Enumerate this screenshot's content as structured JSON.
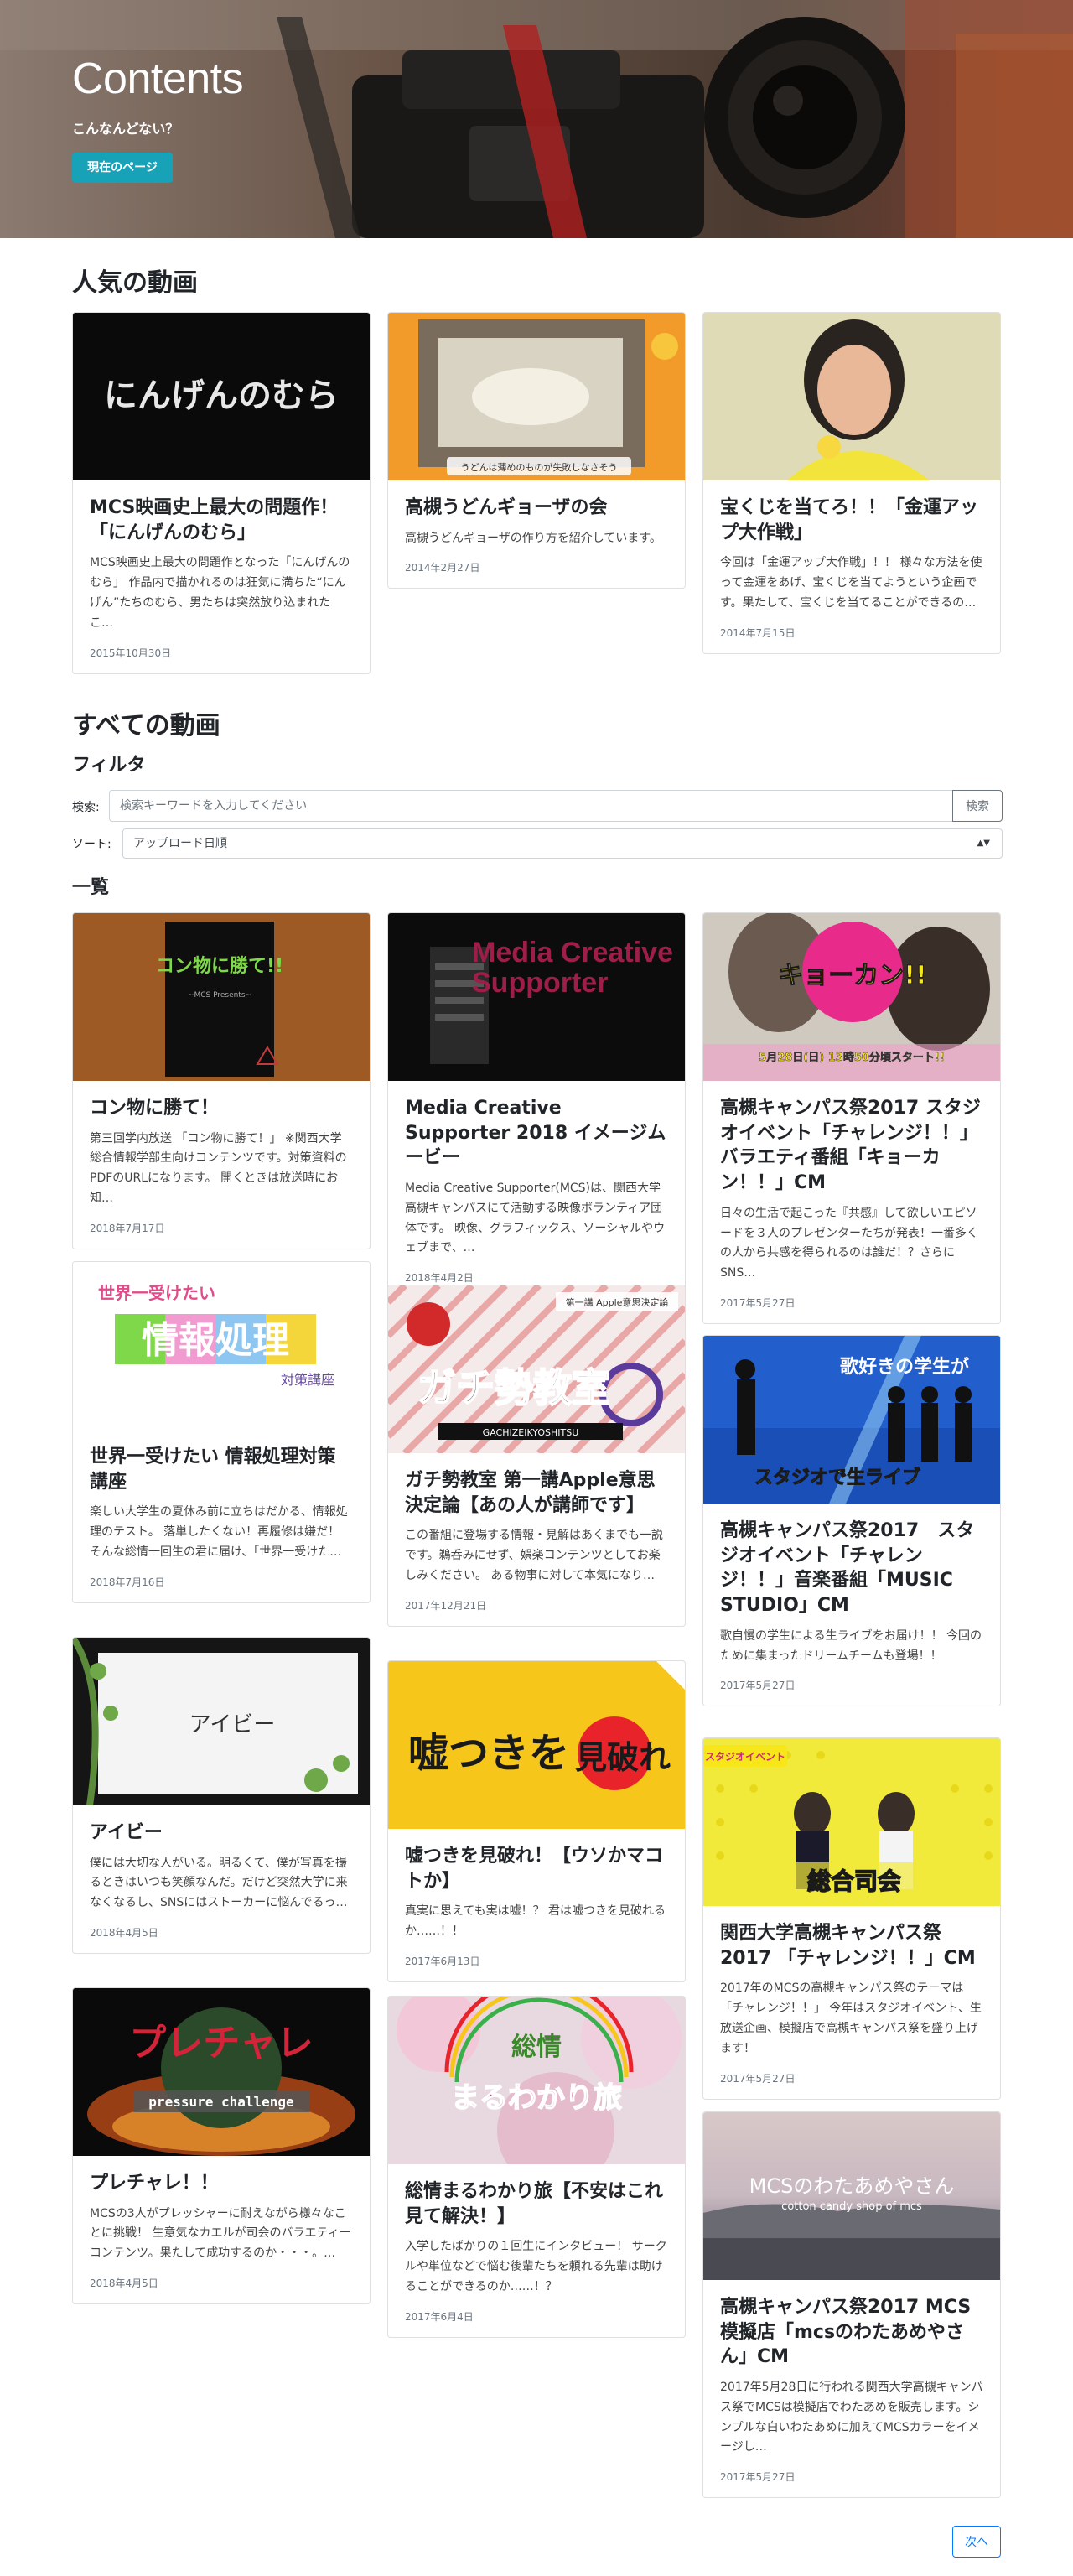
{
  "hero": {
    "title": "Contents",
    "subtitle": "こんなんどない？",
    "button_label": "現在のページ"
  },
  "popular": {
    "title": "人気の動画",
    "cards": [
      {
        "title": "MCS映画史上最大の問題作！「にんげんのむら」",
        "desc": "MCS映画史上最大の問題作となった「にんげんのむら」 作品内で描かれるのは狂気に満ちた“にんげん”たちのむら、男たちは突然放り込まれたこ…",
        "date": "2015年10月30日",
        "thumb_text": "にんげんのむら"
      },
      {
        "title": "高槻うどんギョーザの会",
        "desc": "高槻うどんギョーザの作り方を紹介しています。",
        "date": "2014年2月27日",
        "thumb_text": "うどんは薄めのものが失敗しなさそう"
      },
      {
        "title": "宝くじを当てろ！！「金運アップ大作戦」",
        "desc": "今回は「金運アップ大作戦」！！ 様々な方法を使って金運をあげ、宝くじを当てようという企画です。果たして、宝くじを当てることができるの…",
        "date": "2014年7月15日",
        "thumb_text": ""
      }
    ]
  },
  "all": {
    "title": "すべての動画",
    "filter_title": "フィルタ",
    "search_label": "検索:",
    "search_placeholder": "検索キーワードを入力してください",
    "search_button": "検索",
    "sort_label": "ソート:",
    "sort_value": "アップロード日順",
    "list_title": "一覧",
    "next_button": "次へ"
  },
  "list": {
    "col1": [
      {
        "title": "コン物に勝て！",
        "desc": "第三回学内放送 「コン物に勝て！」 ※関西大学総合情報学部生向けコンテンツです。対策資料のPDFのURLになります。 開くときは放送時にお知…",
        "date": "2018年7月17日",
        "thumb_text": "コン物に勝て!!",
        "thumb_sub": "~MCS Presents~"
      },
      {
        "title": "世界一受けたい 情報処理対策講座",
        "desc": "楽しい大学生の夏休み前に立ちはだかる、情報処理のテスト。 落単したくない！再履修は嫌だ！ そんな総情一回生の君に届け、「世界一受けた…",
        "date": "2018年7月16日",
        "thumb_text": "情報処理",
        "thumb_sub": "世界一受けたい",
        "thumb_sub2": "対策講座"
      },
      {
        "title": "アイビー",
        "desc": "僕には大切な人がいる。明るくて、僕が写真を撮るときはいつも笑顔なんだ。だけど突然大学に来なくなるし、SNSにはストーカーに悩んでるっ…",
        "date": "2018年4月5日",
        "thumb_text": "アイビー"
      },
      {
        "title": "プレチャレ！！",
        "desc": "MCSの3人がプレッシャーに耐えながら様々なことに挑戦！ 生意気なカエルが司会のバラエティーコンテンツ。果たして成功するのか・・・。…",
        "date": "2018年4月5日",
        "thumb_text": "プレチャレ",
        "thumb_sub": "pressure challenge"
      }
    ],
    "col2": [
      {
        "title": "Media Creative Supporter 2018 イメージムービー",
        "desc": "Media Creative Supporter(MCS)は、関西大学高槻キャンパスにて活動する映像ボランティア団体です。 映像、グラフィックス、ソーシャルやウェブまで、…",
        "date": "2018年4月2日",
        "thumb_text": "Media Creative Supporter"
      },
      {
        "title": "ガチ勢教室 第一講Apple意思決定論【あの人が講師です】",
        "desc": "この番組に登場する情報・見解はあくまでも一説です。鵜呑みにせず、娯楽コンテンツとしてお楽しみください。 ある物事に対して本気になり…",
        "date": "2017年12月21日",
        "thumb_text": "ガチ勢教室",
        "thumb_sub": "GACHIZEIKYOSHITSU",
        "thumb_sub2": "第一講 Apple意思決定論"
      },
      {
        "title": "嘘つきを見破れ！【ウソかマコトか】",
        "desc": "真実に思えても実は嘘！？ 君は嘘つきを見破れるか……！！",
        "date": "2017年6月13日",
        "thumb_text": "嘘つきを",
        "thumb_sub": "見破れ"
      },
      {
        "title": "総情まるわかり旅【不安はこれ見て解決！】",
        "desc": "入学したばかりの１回生にインタビュー！ サークルや単位などで悩む後輩たちを頼れる先輩は助けることができるのか……！？",
        "date": "2017年6月4日",
        "thumb_text": "まるわかり旅",
        "thumb_sub": "総情"
      }
    ],
    "col3": [
      {
        "title": "高槻キャンパス祭2017 スタジオイベント「チャレンジ！！」 バラエティ番組「キョーカン！！」CM",
        "desc": "日々の生活で起こった『共感』して欲しいエピソードを３人のプレゼンターたちが発表！一番多くの人から共感を得られるのは誰だ！？さらにSNS…",
        "date": "2017年5月27日",
        "thumb_text": "キョーカン!!",
        "thumb_sub": "5月28日(日) 13時50分頃スタート!!"
      },
      {
        "title": "高槻キャンパス祭2017　スタジオイベント「チャレンジ！！」音楽番組「MUSIC STUDIO」CM",
        "desc": "歌自慢の学生による生ライブをお届け！！ 今回のために集まったドリームチームも登場！！",
        "date": "2017年5月27日",
        "thumb_text": "歌好きの学生が",
        "thumb_sub": "スタジオで生ライブ"
      },
      {
        "title": "関西大学高槻キャンパス祭2017 「チャレンジ！！」CM",
        "desc": "2017年のMCSの高槻キャンパス祭のテーマは「チャレンジ！！」 今年はスタジオイベント、生放送企画、模擬店で高槻キャンパス祭を盛り上げます！",
        "date": "2017年5月27日",
        "thumb_text": "総合司会",
        "thumb_sub": "スタジオイベント"
      },
      {
        "title": "高槻キャンパス祭2017 MCS 模擬店「mcsのわたあめやさん」CM",
        "desc": "2017年5月28日に行われる関西大学高槻キャンパス祭でMCSは模擬店でわたあめを販売します。シンプルな白いわたあめに加えてMCSカラーをイメージし…",
        "date": "2017年5月27日",
        "thumb_text": "MCSのわたあめやさん",
        "thumb_sub": "cotton candy shop of mcs"
      }
    ]
  },
  "colors": {
    "accent": "#17a2b8",
    "primary": "#007bff",
    "text": "#212529",
    "muted": "#6c757d"
  }
}
